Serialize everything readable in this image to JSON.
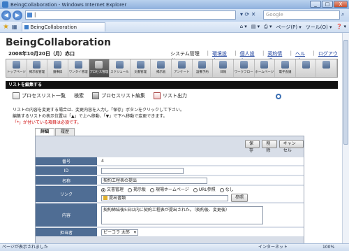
{
  "window": {
    "title": "BeingCollaboration - Windows Internet Explorer",
    "minimize": "_",
    "maximize": "□",
    "close": "X"
  },
  "addressbar": {
    "url": "|",
    "back": "◀",
    "forward": "▶",
    "tools": "▾ ⟳ ✕",
    "search_placeholder": "Google",
    "search_icon": "⌕"
  },
  "tabs": {
    "active_label": "BeingCollaboration",
    "commands": [
      "⌂ ▾",
      "▤ ▾",
      "⎙ ▾",
      "ページ(P) ▾",
      "ツール(O) ▾",
      "❓ ▾"
    ]
  },
  "app": {
    "title": "BeingCollaboration",
    "date": "2008年10月20日（月）赤口",
    "top_links": [
      "システム管理者",
      "環境設定",
      "個人設定",
      "契約情報",
      "ヘルプ",
      "ログアウト"
    ]
  },
  "menu": [
    {
      "label": "トップページ",
      "icon": "home-icon"
    },
    {
      "label": "掲示板管理",
      "icon": "board-icon"
    },
    {
      "label": "議事録",
      "icon": "minutes-icon"
    },
    {
      "label": "ワンタイ管理",
      "icon": "task-icon"
    },
    {
      "label": "プロセス管理",
      "icon": "process-icon",
      "active": true
    },
    {
      "label": "スケジュール",
      "icon": "schedule-icon"
    },
    {
      "label": "文書管理",
      "icon": "folder-icon"
    },
    {
      "label": "掲示板",
      "icon": "notice-icon"
    },
    {
      "label": "アンケート",
      "icon": "survey-icon"
    },
    {
      "label": "設備予約",
      "icon": "equipment-icon"
    },
    {
      "label": "日報",
      "icon": "report-icon"
    },
    {
      "label": "ワークフロー",
      "icon": "workflow-icon"
    },
    {
      "label": "ホームページ",
      "icon": "web-icon"
    },
    {
      "label": "電子会議",
      "icon": "meeting-icon"
    },
    {
      "label": "",
      "icon": "more-icon"
    },
    {
      "label": "",
      "icon": "more-icon"
    }
  ],
  "section": {
    "title": "リストを編集する"
  },
  "actions": [
    {
      "label": "プロセスリスト一覧",
      "icon": "list-icon"
    },
    {
      "label": "検索",
      "icon": "search-icon"
    },
    {
      "label": "プロセスリスト編集",
      "icon": "edit-icon"
    },
    {
      "label": "リスト出力",
      "icon": "export-icon"
    }
  ],
  "instructions": {
    "line1": "リストの内容を変更する場合は、変更内容を入力し「保存」ボタンをクリックして下さい。",
    "line2": "編集するリストの表示位置は「▲」で上へ移動、「▼」で下へ移動で変更できます。",
    "line3": "「*」が付いている項目は必須です。"
  },
  "subtabs": [
    "詳細",
    "履歴"
  ],
  "buttons": {
    "save": "保存",
    "delete": "削除",
    "cancel": "キャンセル"
  },
  "form": {
    "number_label": "番号",
    "number_value": "4",
    "id_label": "ID",
    "id_value": "",
    "name_label": "名称",
    "name_value": "契約工程表の提出",
    "link_label": "リンク",
    "link_options": [
      "文書管理",
      "掲示板",
      "現場ホームページ",
      "URL参照",
      "なし"
    ],
    "link_selected": 0,
    "link_file": "提出書類",
    "link_browse": "参照",
    "content_label": "内容",
    "content_value": "契約締結後5日以内に契約工程表が提出された。（契約後、変更後）",
    "person_label": "担当者",
    "person_value": "ピーコラ 太郎"
  },
  "status": {
    "text": "ページが表示されました",
    "zone": "インターネット",
    "zoom": "100%"
  }
}
